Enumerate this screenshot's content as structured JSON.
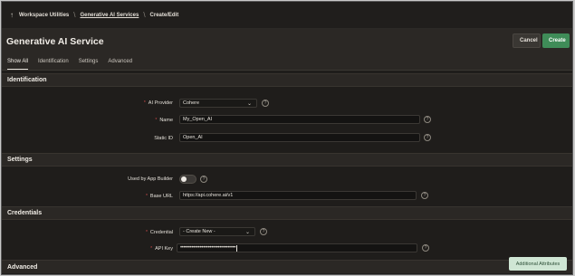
{
  "breadcrumb": {
    "items": [
      "Workspace Utilities",
      "Generative AI Services",
      "Create/Edit"
    ]
  },
  "header": {
    "title": "Generative AI Service",
    "cancel_label": "Cancel",
    "create_label": "Create"
  },
  "tabs": [
    {
      "label": "Show All"
    },
    {
      "label": "Identification"
    },
    {
      "label": "Settings"
    },
    {
      "label": "Advanced"
    }
  ],
  "sections": {
    "identification": "Identification",
    "settings": "Settings",
    "credentials": "Credentials",
    "advanced": "Advanced"
  },
  "fields": {
    "ai_provider": {
      "label": "AI Provider",
      "value": "Cohere"
    },
    "name": {
      "label": "Name",
      "value": "My_Open_AI"
    },
    "static_id": {
      "label": "Static ID",
      "value": "Open_AI"
    },
    "used_by_app_builder": {
      "label": "Used by App Builder",
      "value": "off"
    },
    "base_url": {
      "label": "Base URL",
      "value": "https://api.cohere.ai/v1"
    },
    "credential": {
      "label": "Credential",
      "value": "- Create New -"
    },
    "api_key": {
      "label": "API Key",
      "value": "••••••••••••••••••••••••••••••••••"
    }
  },
  "help_glyph": "?",
  "chevron_glyph": "⌄",
  "additional_attributes_label": "Additional Attributes",
  "colors": {
    "accent_create": "#3f8c58",
    "required_marker": "#d24b4b",
    "background": "#1f1d1b"
  },
  "icons": [
    "home-up-icon",
    "chevron-down-icon",
    "help-icon"
  ]
}
